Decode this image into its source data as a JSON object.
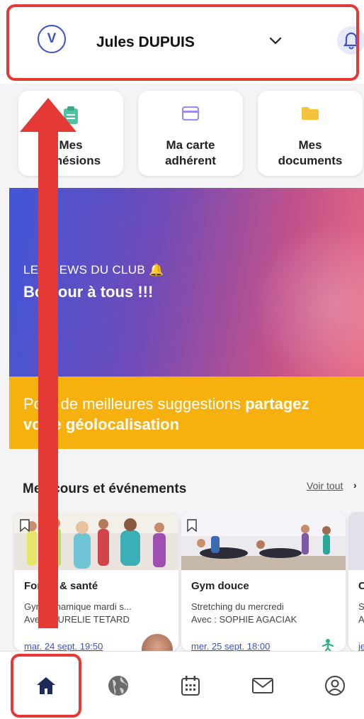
{
  "header": {
    "avatar_initial": "V",
    "user_name": "Jules DUPUIS",
    "icons": [
      "chevron-down-icon",
      "bell-icon"
    ]
  },
  "shortcuts": [
    {
      "label": "Mes\nadhésions",
      "icon": "clipboard-icon",
      "color": "#4fc3a1"
    },
    {
      "label": "Ma carte\nadhérent",
      "icon": "card-icon",
      "color": "#9b8cf0"
    },
    {
      "label": "Mes\ndocuments",
      "icon": "folder-icon",
      "color": "#f5c23e"
    }
  ],
  "news": {
    "kicker": "LES NEWS DU CLUB 🔔",
    "message": "Bonjour à tous !!!"
  },
  "geoloc": {
    "text_regular": "Pour de meilleures suggestions ",
    "text_bold_1": "partagez",
    "text_bold_2": "votre géolocalisation"
  },
  "courses": {
    "title": "Mes cours et événements",
    "see_all": "Voir tout",
    "see_all_arrow": "›",
    "cards": [
      {
        "category": "Forme & santé",
        "name": "Gym dynamique mardi s...",
        "with": "Avec : AURELIE TETARD",
        "date": "mar. 24 sept. 19:50"
      },
      {
        "category": "Gym douce",
        "name": "Stretching du mercredi",
        "with": "Avec : SOPHIE AGACIAK",
        "date": "mer. 25 sept. 18:00"
      },
      {
        "category": "C",
        "name": "S",
        "with": "A",
        "date": "je"
      }
    ]
  },
  "bottom_nav": [
    {
      "icon": "home-icon",
      "active": true
    },
    {
      "icon": "globe-icon",
      "active": false
    },
    {
      "icon": "calendar-icon",
      "active": false
    },
    {
      "icon": "mail-icon",
      "active": false
    },
    {
      "icon": "user-icon",
      "active": false
    }
  ],
  "colors": {
    "primary": "#3b4fd1",
    "highlight": "#e53935",
    "geo_banner": "#f7b10f"
  }
}
